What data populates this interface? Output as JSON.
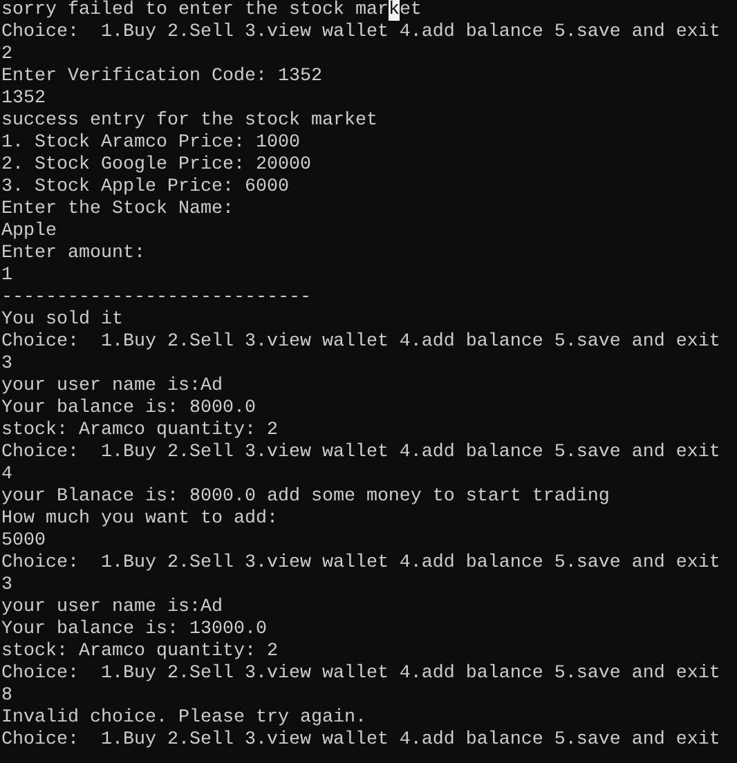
{
  "console": {
    "lines": [
      {
        "kind": "cursor",
        "segments": [
          {
            "text": "sorry failed to enter the stock mar",
            "cursor": false
          },
          {
            "text": "k",
            "cursor": true
          },
          {
            "text": "et",
            "cursor": false
          }
        ]
      },
      {
        "kind": "plain",
        "text": "Choice:  1.Buy 2.Sell 3.view wallet 4.add balance 5.save and exit"
      },
      {
        "kind": "plain",
        "text": "2"
      },
      {
        "kind": "plain",
        "text": "Enter Verification Code: 1352"
      },
      {
        "kind": "plain",
        "text": "1352"
      },
      {
        "kind": "plain",
        "text": "success entry for the stock market"
      },
      {
        "kind": "plain",
        "text": "1. Stock Aramco Price: 1000"
      },
      {
        "kind": "plain",
        "text": "2. Stock Google Price: 20000"
      },
      {
        "kind": "plain",
        "text": "3. Stock Apple Price: 6000"
      },
      {
        "kind": "plain",
        "text": "Enter the Stock Name:"
      },
      {
        "kind": "plain",
        "text": "Apple"
      },
      {
        "kind": "plain",
        "text": "Enter amount:"
      },
      {
        "kind": "plain",
        "text": "1"
      },
      {
        "kind": "plain",
        "text": "----------------------------"
      },
      {
        "kind": "plain",
        "text": "You sold it"
      },
      {
        "kind": "plain",
        "text": "Choice:  1.Buy 2.Sell 3.view wallet 4.add balance 5.save and exit"
      },
      {
        "kind": "plain",
        "text": "3"
      },
      {
        "kind": "plain",
        "text": "your user name is:Ad"
      },
      {
        "kind": "plain",
        "text": "Your balance is: 8000.0"
      },
      {
        "kind": "plain",
        "text": "stock: Aramco quantity: 2"
      },
      {
        "kind": "plain",
        "text": "Choice:  1.Buy 2.Sell 3.view wallet 4.add balance 5.save and exit"
      },
      {
        "kind": "plain",
        "text": "4"
      },
      {
        "kind": "plain",
        "text": "your Blanace is: 8000.0 add some money to start trading"
      },
      {
        "kind": "plain",
        "text": "How much you want to add:"
      },
      {
        "kind": "plain",
        "text": "5000"
      },
      {
        "kind": "plain",
        "text": "Choice:  1.Buy 2.Sell 3.view wallet 4.add balance 5.save and exit"
      },
      {
        "kind": "plain",
        "text": "3"
      },
      {
        "kind": "plain",
        "text": "your user name is:Ad"
      },
      {
        "kind": "plain",
        "text": "Your balance is: 13000.0"
      },
      {
        "kind": "plain",
        "text": "stock: Aramco quantity: 2"
      },
      {
        "kind": "plain",
        "text": "Choice:  1.Buy 2.Sell 3.view wallet 4.add balance 5.save and exit"
      },
      {
        "kind": "plain",
        "text": "8"
      },
      {
        "kind": "plain",
        "text": "Invalid choice. Please try again."
      },
      {
        "kind": "plain",
        "text": "Choice:  1.Buy 2.Sell 3.view wallet 4.add balance 5.save and exit"
      }
    ]
  }
}
